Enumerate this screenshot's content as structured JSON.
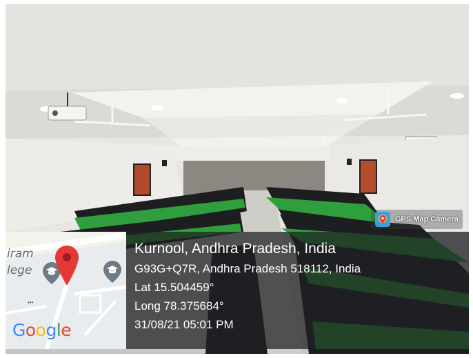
{
  "badge": {
    "label": "GPS Map Camera",
    "icon": "gps-map-camera-icon"
  },
  "map": {
    "place_text_1": "iram",
    "place_text_2": "lege",
    "dots": "•••",
    "google_letters": [
      {
        "ch": "G",
        "color": "#4285F4"
      },
      {
        "ch": "o",
        "color": "#EA4335"
      },
      {
        "ch": "o",
        "color": "#FBBC05"
      },
      {
        "ch": "g",
        "color": "#4285F4"
      },
      {
        "ch": "l",
        "color": "#34A853"
      },
      {
        "ch": "e",
        "color": "#EA4335"
      }
    ],
    "pin_color": "#E53935",
    "poi_color": "#6b7c88"
  },
  "info": {
    "city": "Kurnool, Andhra Pradesh, India",
    "address": "G93G+Q7R, Andhra Pradesh 518112, India",
    "lat": "Lat 15.504459°",
    "long": "Long 78.375684°",
    "datetime": "31/08/21 05:01 PM"
  },
  "colors": {
    "seat_green": "#2f9e3c",
    "seat_black": "#1b1d1f",
    "wall": "#eceae6",
    "floor": "#c9c7c2"
  }
}
